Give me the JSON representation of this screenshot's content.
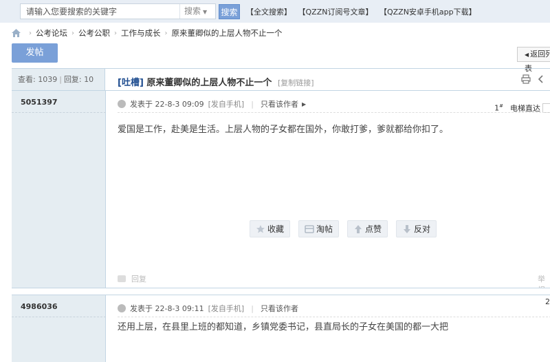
{
  "search": {
    "placeholder": "请输入您要搜索的关键字",
    "select_label": "搜索",
    "button_label": "搜索"
  },
  "top_links": [
    "【全文搜索】",
    "【QZZN订阅号文章】",
    "【QZZN安卓手机app下载】"
  ],
  "breadcrumb": {
    "items": [
      "公考论坛",
      "公考公职",
      "工作与成长",
      "原来董卿似的上层人物不止一个"
    ]
  },
  "post_button": "发帖",
  "return_button": "返回列表",
  "thread": {
    "views_label": "查看:",
    "views": "1039",
    "replies_label": "回复:",
    "replies": "10",
    "tag": "[吐槽]",
    "title": "原来董卿似的上层人物不止一个",
    "copy_link": "[复制链接]"
  },
  "posts": [
    {
      "author": "5051397",
      "posted_label": "发表于",
      "time": "22-8-3 09:09",
      "source": "[发自手机]",
      "only_author": "只看该作者",
      "floor": "1",
      "floor_sup": "#",
      "elevator": "电梯直达",
      "content": "爱国是工作，赴美是生活。上层人物的子女都在国外，你敢打爹，爹就都给你扣了。",
      "actions": {
        "favorite": "收藏",
        "bowl": "淘帖",
        "like": "点赞",
        "dislike": "反对"
      },
      "reply": "回复",
      "report": "举报"
    },
    {
      "author": "4986036",
      "posted_label": "发表于",
      "time": "22-8-3 09:11",
      "source": "[发自手机]",
      "only_author": "只看该作者",
      "floor": "2",
      "content": "还用上层，在县里上班的都知道，乡镇党委书记，县直局长的子女在美国的都一大把"
    }
  ],
  "colors": {
    "accent": "#7aa0d8",
    "sidebar_bg": "#e5edf2",
    "border": "#c2d5e3",
    "title_tag": "#1e4c8f"
  }
}
